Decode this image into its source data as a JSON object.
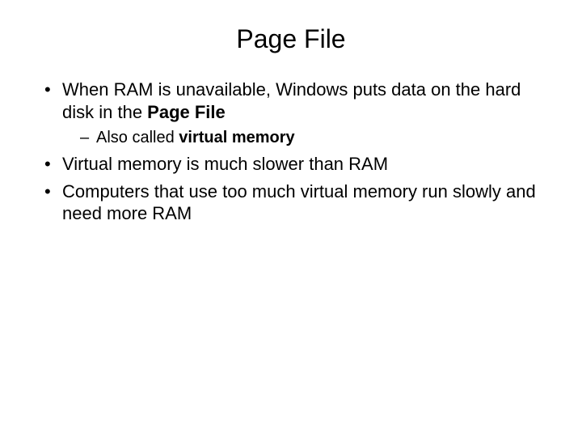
{
  "title": "Page File",
  "bullets": {
    "b1_pre": "When RAM is unavailable, Windows puts data on the hard disk in the ",
    "b1_bold": "Page File",
    "b1_sub_pre": "Also called ",
    "b1_sub_bold": "virtual memory",
    "b2": "Virtual memory is much slower than RAM",
    "b3": "Computers that use too much virtual memory run slowly and need more RAM"
  }
}
